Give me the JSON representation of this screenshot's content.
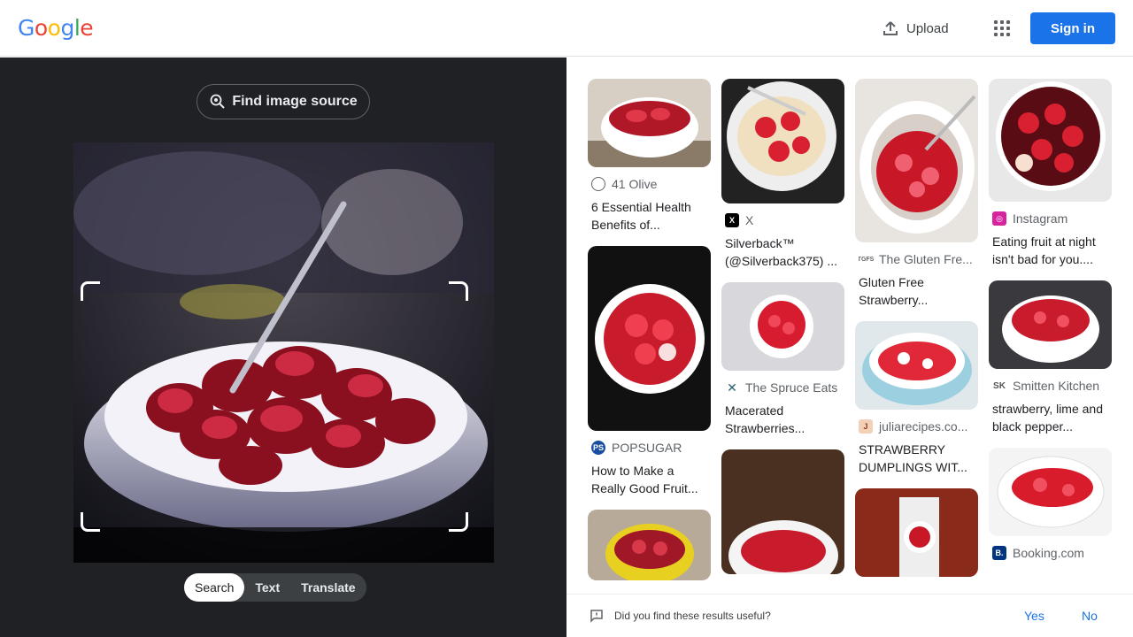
{
  "header": {
    "logo_letters": [
      "G",
      "o",
      "o",
      "g",
      "l",
      "e"
    ],
    "upload_label": "Upload",
    "apps_icon": "apps-grid-icon",
    "signin_label": "Sign in"
  },
  "lens": {
    "find_source_label": "Find image source",
    "modes": [
      "Search",
      "Text",
      "Translate"
    ],
    "active_mode": "Search"
  },
  "results": [
    {
      "source": "41 Olive",
      "title": "6 Essential Health Benefits of...",
      "icon": "globe-icon"
    },
    {
      "source": "POPSUGAR",
      "title": "How to Make a Really Good Fruit...",
      "icon": "popsugar-icon"
    },
    {
      "source": "X",
      "title": "Silverback™ (@Silverback375) ...",
      "icon": "x-logo-icon"
    },
    {
      "source": "The Spruce Eats",
      "title": "Macerated Strawberries...",
      "icon": "spruce-eats-icon"
    },
    {
      "source": "The Gluten Fre...",
      "title": "Gluten Free Strawberry...",
      "icon": "gluten-free-icon"
    },
    {
      "source": "juliarecipes.co...",
      "title": "STRAWBERRY DUMPLINGS WIT...",
      "icon": "julia-recipes-icon"
    },
    {
      "source": "Instagram",
      "title": "Eating fruit at night isn't bad for you....",
      "icon": "instagram-icon"
    },
    {
      "source": "Smitten Kitchen",
      "title": "strawberry, lime and black pepper...",
      "icon": "smitten-kitchen-icon"
    },
    {
      "source": "Booking.com",
      "title": "",
      "icon": "booking-icon"
    }
  ],
  "feedback": {
    "question": "Did you find these results useful?",
    "yes": "Yes",
    "no": "No"
  },
  "colors": {
    "google_blue": "#4285F4",
    "google_red": "#EA4335",
    "google_yellow": "#FBBC05",
    "google_green": "#34A853",
    "accent": "#1a73e8",
    "dark_pane": "#202124"
  }
}
